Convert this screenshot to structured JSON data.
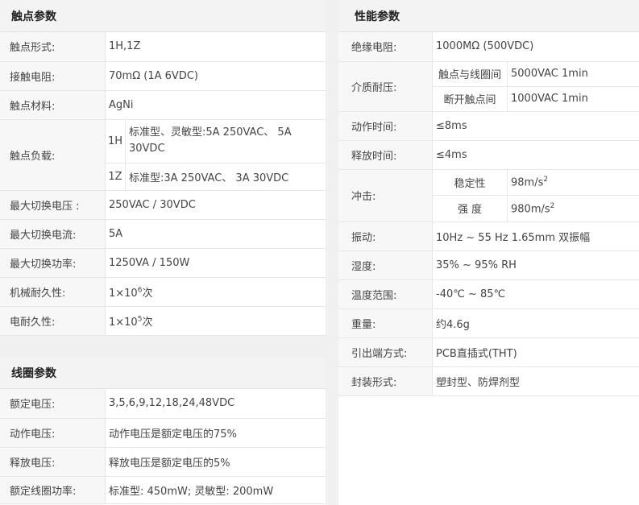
{
  "contact": {
    "title": "触点参数",
    "rows": {
      "form": {
        "label": "触点形式:",
        "value": "1H,1Z"
      },
      "resistance": {
        "label": "接触电阻:",
        "value": "70mΩ (1A 6VDC)"
      },
      "material": {
        "label": "触点材料:",
        "value": "AgNi"
      },
      "load": {
        "label": "触点负载:",
        "h_tag": "1H",
        "h_value": "标准型、灵敏型:5A 250VAC、 5A 30VDC",
        "z_tag": "1Z",
        "z_value": "标准型:3A 250VAC、 3A 30VDC"
      },
      "max_voltage": {
        "label": "最大切换电压 :",
        "value": "250VAC / 30VDC"
      },
      "max_current": {
        "label": "最大切换电流:",
        "value": "5A"
      },
      "max_power": {
        "label": "最大切换功率:",
        "value": "1250VA / 150W"
      },
      "mech_life": {
        "label": "机械耐久性:",
        "value_base": "1×10",
        "value_exp": "6",
        "value_unit": "次"
      },
      "elec_life": {
        "label": "电耐久性:",
        "value_base": "1×10",
        "value_exp": "5",
        "value_unit": "次"
      }
    }
  },
  "coil": {
    "title": "线圈参数",
    "rows": {
      "rated_voltage": {
        "label": "额定电压:",
        "value": "3,5,6,9,12,18,24,48VDC"
      },
      "operate_voltage": {
        "label": "动作电压:",
        "value": "动作电压是额定电压的75%"
      },
      "release_voltage": {
        "label": "释放电压:",
        "value": "释放电压是额定电压的5%"
      },
      "rated_power": {
        "label": "额定线圈功率:",
        "value": "标准型: 450mW; 灵敏型: 200mW"
      }
    }
  },
  "performance": {
    "title": "性能参数",
    "rows": {
      "insulation": {
        "label": "绝缘电阻:",
        "value": "1000MΩ (500VDC)"
      },
      "dielectric": {
        "label": "介质耐压:",
        "a_label": "触点与线圈间",
        "a_value": "5000VAC 1min",
        "b_label": "断开触点间",
        "b_value": "1000VAC 1min"
      },
      "operate_time": {
        "label": "动作时间:",
        "value": "≤8ms"
      },
      "release_time": {
        "label": "释放时间:",
        "value": "≤4ms"
      },
      "shock": {
        "label": "冲击:",
        "a_label": "稳定性",
        "a_value": "98m/s",
        "a_exp": "2",
        "b_label": "强 度",
        "b_value": "980m/s",
        "b_exp": "2"
      },
      "vibration": {
        "label": "振动:",
        "value": "10Hz ~ 55 Hz 1.65mm 双振幅"
      },
      "humidity": {
        "label": "湿度:",
        "value": "35% ~ 95% RH"
      },
      "temperature": {
        "label": "温度范围:",
        "value": "-40℃ ~ 85℃"
      },
      "weight": {
        "label": "重量:",
        "value": "约4.6g"
      },
      "terminal": {
        "label": "引出端方式:",
        "value": "PCB直插式(THT)"
      },
      "package": {
        "label": "封装形式:",
        "value": "塑封型、防焊剂型"
      }
    }
  }
}
